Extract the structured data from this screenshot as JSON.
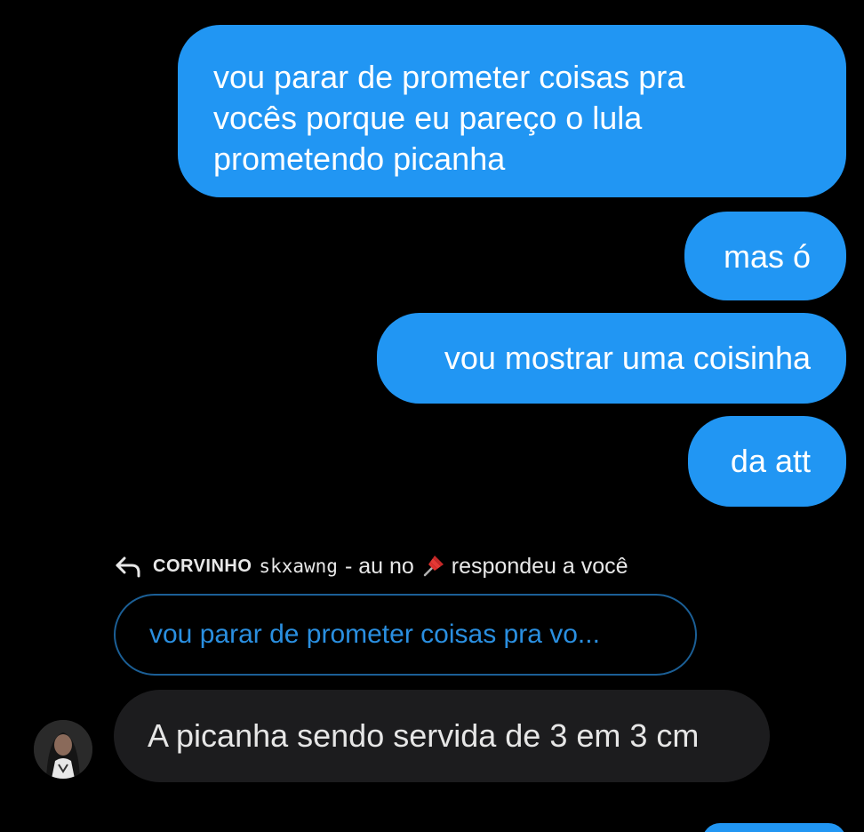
{
  "messages": {
    "sent": [
      {
        "text": "vou parar de prometer coisas pra\nvocês porque eu pareço o lula\nprometendo picanha"
      },
      {
        "text": "mas ó"
      },
      {
        "text": "vou mostrar uma coisinha"
      },
      {
        "text": "da att"
      }
    ],
    "reply": {
      "name_caps": "CORVINHO",
      "name_mono": "skxawng",
      "name_tail": "- au no",
      "action": "respondeu a você",
      "quoted_text": "vou parar de prometer coisas pra vo...",
      "text": "A picanha sendo servida de 3 em 3 cm"
    }
  },
  "icons": {
    "reply": "reply-arrow-icon",
    "pin": "pushpin-icon",
    "avatar": "avatar"
  },
  "colors": {
    "background": "#000000",
    "sent_bubble": "#2196F3",
    "received_bubble": "#1c1c1e",
    "quote_text": "#2a8fe0"
  }
}
